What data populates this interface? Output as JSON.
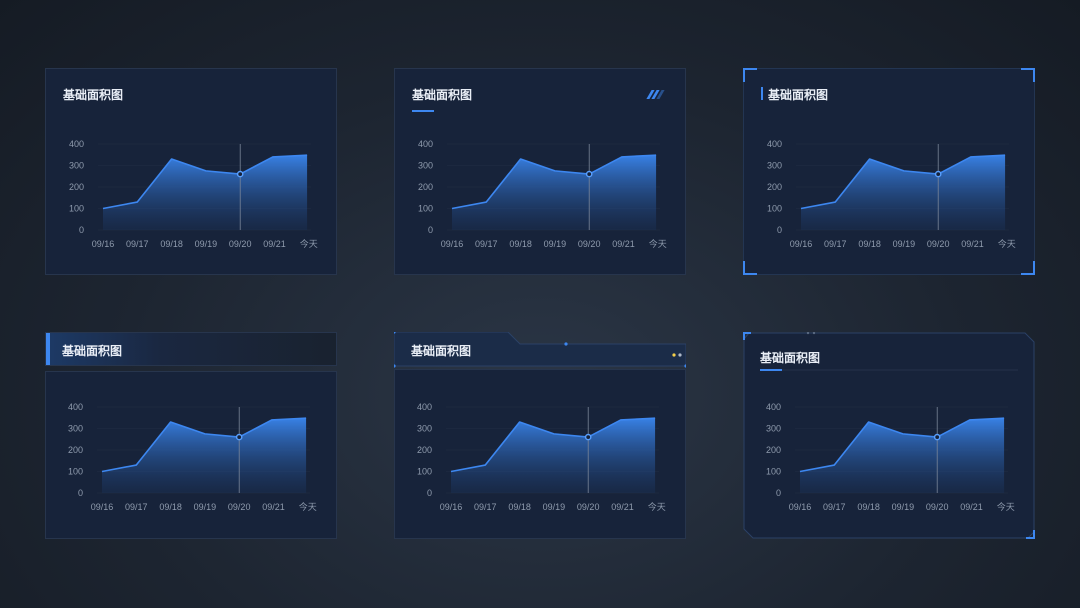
{
  "panels": [
    {
      "title": "基础面积图"
    },
    {
      "title": "基础面积图"
    },
    {
      "title": "基础面积图"
    },
    {
      "title": "基础面积图"
    },
    {
      "title": "基础面积图"
    },
    {
      "title": "基础面积图"
    }
  ],
  "colors": {
    "accent": "#3d87f0",
    "panel_bg": "#17233a",
    "tick": "#8f9bad"
  },
  "chart_data": {
    "type": "area",
    "categories": [
      "09/16",
      "09/17",
      "09/18",
      "09/19",
      "09/20",
      "09/21",
      "今天"
    ],
    "x": [
      0,
      1,
      2,
      3,
      4,
      4.95,
      5.95
    ],
    "values": [
      100,
      130,
      330,
      275,
      260,
      340,
      348
    ],
    "x_tick_positions": [
      0,
      1,
      2,
      3,
      4,
      5,
      6
    ],
    "y_ticks": [
      0,
      100,
      200,
      300,
      400
    ],
    "ylim": [
      0,
      400
    ],
    "highlight_category": "09/20",
    "grid": false
  }
}
